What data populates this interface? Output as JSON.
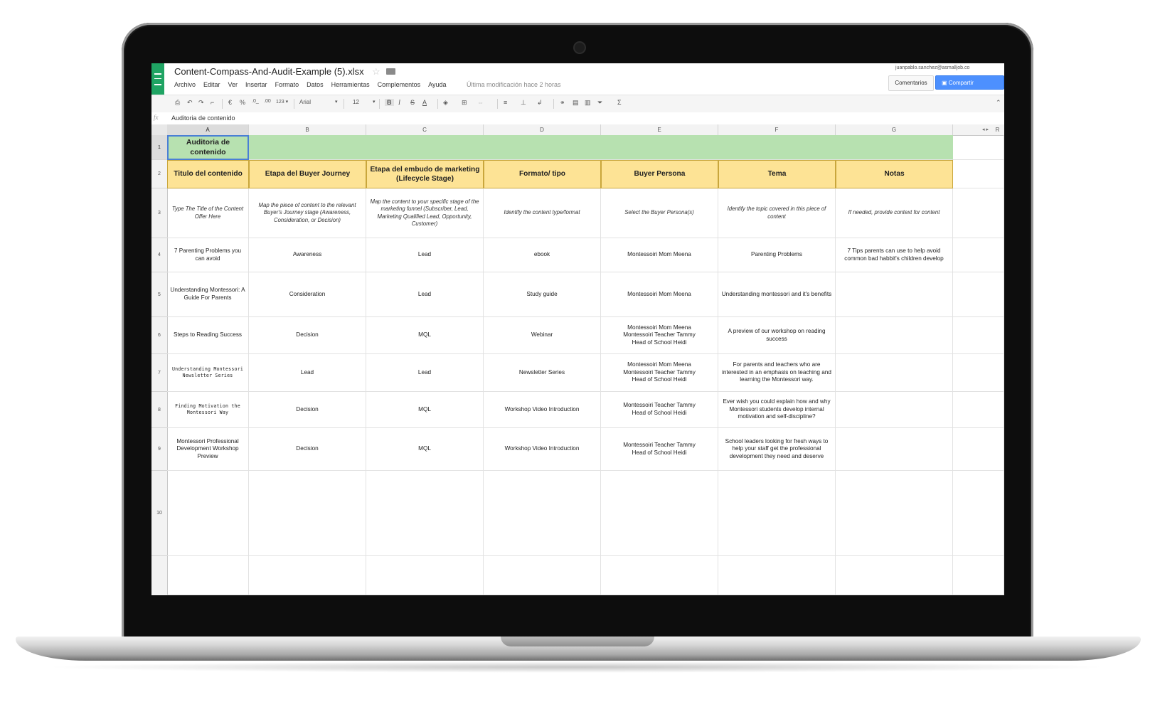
{
  "app": {
    "doc_title": "Content-Compass-And-Audit-Example (5).xlsx",
    "menu": [
      "Archivo",
      "Editar",
      "Ver",
      "Insertar",
      "Formato",
      "Datos",
      "Herramientas",
      "Complementos",
      "Ayuda"
    ],
    "last_edit": "Última modificación hace 2 horas",
    "user_email": "juanpablo.sanchez@asmalljob.co",
    "comments_label": "Comentarios",
    "share_label": "Compartir"
  },
  "toolbar": {
    "currency": "€",
    "percent": "%",
    "decimal_less": ".0_",
    "decimal_more": ".00",
    "number_format": "123 ▾",
    "font": "Arial",
    "font_size": "12",
    "bold": "B",
    "italic": "I",
    "strike": "S",
    "text_color": "A",
    "sum": "Σ"
  },
  "formula_bar": {
    "fx": "fx",
    "value": "Auditoria de contenido"
  },
  "columns": [
    "A",
    "B",
    "C",
    "D",
    "E",
    "F",
    "G",
    "R"
  ],
  "rows": [
    "1",
    "2",
    "3",
    "4",
    "5",
    "6",
    "7",
    "8",
    "9",
    "10"
  ],
  "sheet": {
    "a1": "Auditoria de contenido",
    "headers": [
      "Titulo del contenido",
      "Etapa del Buyer Journey",
      "Etapa del embudo de marketing\n(Lifecycle Stage)",
      "Formato/ tipo",
      "Buyer Persona",
      "Tema",
      "Notas"
    ],
    "hints": [
      "Type The Title of the Content Offer Here",
      "Map the piece of content to the relevant Buyer's Journey stage (Awareness, Consideration, or Decision)",
      "Map the content to your specific stage of the marketing funnel (Subscriber, Lead, Marketing Qualified Lead, Opportunity, Customer)",
      "Identify the content type/format",
      "Select the Buyer Persona(s)",
      "Identify the topic covered in this piece of content",
      "If needed, provide context for content"
    ],
    "rows": [
      [
        "7 Parenting Problems you can avoid",
        "Awareness",
        "Lead",
        "ebook",
        "Montessoiri Mom Meena",
        "Parenting Problems",
        "7 Tips parents can use to help avoid common bad habbit's children develop"
      ],
      [
        "Understanding Montessori: A Guide For Parents",
        "Consideration",
        "Lead",
        "Study guide",
        "Montessoiri Mom Meena",
        "Understanding montessori and it's benefits",
        ""
      ],
      [
        "Steps to Reading Success",
        "Decision",
        "MQL",
        "Webinar",
        "Montessoiri Mom Meena\nMontessoiri Teacher Tammy\nHead of School Heidi",
        "A preview of our workshop on reading success",
        ""
      ],
      [
        "Understanding Montessori Newsletter Series",
        "Lead",
        "Lead",
        "Newsletter Series",
        "Montessoiri Mom Meena\nMontessoiri Teacher Tammy\nHead of School Heidi",
        "For parents and teachers who are interested in an emphasis on teaching and learning the Montessori way.",
        ""
      ],
      [
        "Finding Motivation the Montessori Way",
        "Decision",
        "MQL",
        "Workshop Video Introduction",
        "Montessoiri Teacher Tammy\nHead of School Heidi",
        "Ever wish you could explain how and why Montessori students develop internal motivation and self-discipline?",
        ""
      ],
      [
        "Montessori Professional Development Workshop Preview",
        "Decision",
        "MQL",
        "Workshop Video Introduction",
        "Montessoiri Teacher Tammy\nHead of School Heidi",
        "School leaders looking for fresh ways to help your staff get the professional development they need and deserve",
        ""
      ]
    ]
  },
  "colors": {
    "sheets_green": "#1fa463",
    "band_green": "#b7e1b0",
    "header_yellow": "#fde395",
    "share_blue": "#4d90fe"
  }
}
